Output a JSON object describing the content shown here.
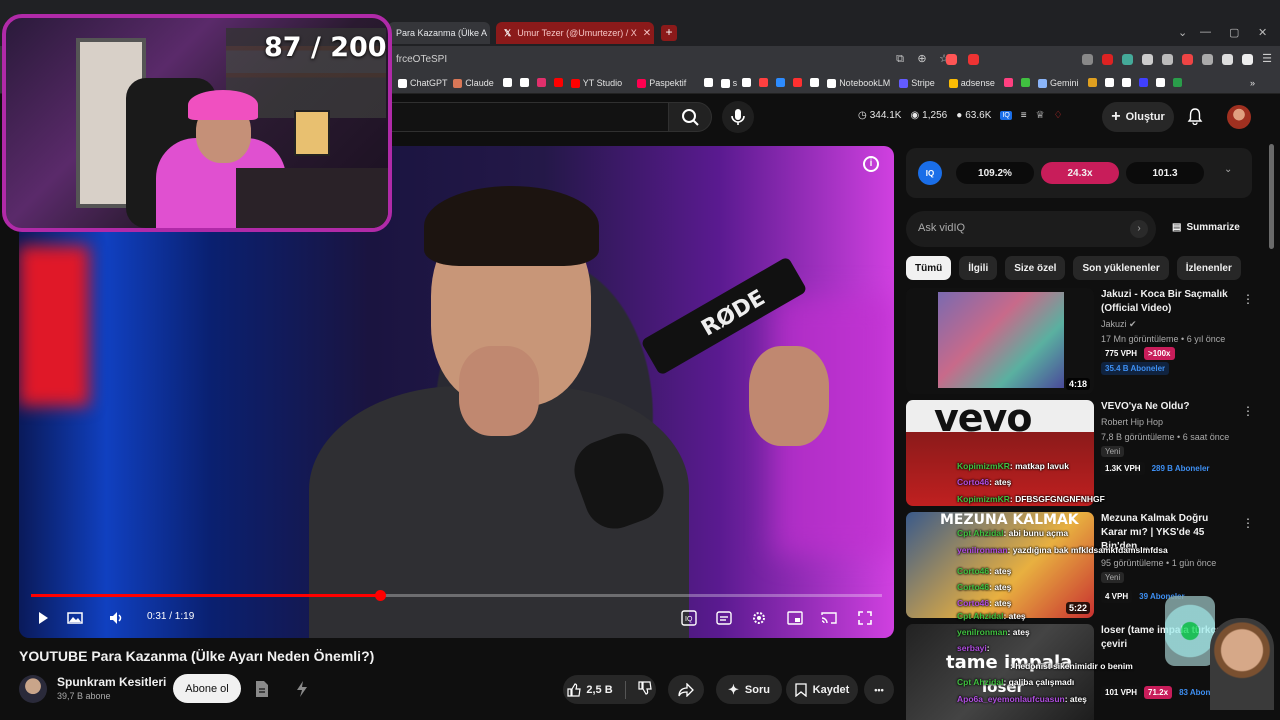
{
  "browser": {
    "tabs": [
      {
        "label": "Para Kazanma (Ülke A",
        "active": true
      },
      {
        "label": "Umur Tezer (@Umurtezer) / X",
        "active": false
      }
    ],
    "new_tab": "+",
    "url": "frceOTeSPI",
    "window_controls": [
      "—",
      "▢",
      "✕"
    ],
    "bookmarks": [
      {
        "label": "ChatGPT",
        "color": "#ffffff"
      },
      {
        "label": "Claude",
        "color": "#d97757"
      },
      {
        "label": "",
        "color": "#ffffff"
      },
      {
        "label": "",
        "color": "#ffffff"
      },
      {
        "label": "",
        "color": "#e1306c"
      },
      {
        "label": "",
        "color": "#ff0000"
      },
      {
        "label": "YT Studio",
        "color": "#ff0000"
      },
      {
        "label": "Paspektif",
        "color": "#ff0050"
      },
      {
        "label": "",
        "color": "#ffffff"
      },
      {
        "label": "s",
        "color": "#ffffff"
      },
      {
        "label": "",
        "color": "#ffffff"
      },
      {
        "label": "",
        "color": "#ff4040"
      },
      {
        "label": "",
        "color": "#2d8cff"
      },
      {
        "label": "",
        "color": "#ff3030"
      },
      {
        "label": "",
        "color": "#ffffff"
      },
      {
        "label": "NotebookLM",
        "color": "#ffffff"
      },
      {
        "label": "Stripe",
        "color": "#635bff"
      },
      {
        "label": "adsense",
        "color": "#fbbc04"
      },
      {
        "label": "",
        "color": "#ff4080"
      },
      {
        "label": "",
        "color": "#40c040"
      },
      {
        "label": "Gemini",
        "color": "#8ab4f8"
      },
      {
        "label": "",
        "color": "#e0a020"
      },
      {
        "label": "",
        "color": "#ffffff"
      },
      {
        "label": "",
        "color": "#ffffff"
      },
      {
        "label": "",
        "color": "#4040ff"
      },
      {
        "label": "",
        "color": "#ffffff"
      },
      {
        "label": "",
        "color": "#2a9d4a"
      }
    ],
    "bookmarks_overflow": "»"
  },
  "youtube": {
    "stats": {
      "views": "344.1K",
      "watchers": "1,256",
      "subs": "63.6K"
    },
    "create_label": "Oluştur"
  },
  "overlay": {
    "goal_counter": "87 / 200"
  },
  "player": {
    "time": "0:31 / 1:19",
    "progress": 0.41,
    "info": "i"
  },
  "video": {
    "title": "YOUTUBE Para Kazanma (Ülke Ayarı Neden Önemli?)",
    "channel": "Spunkram Kesitleri",
    "subscribers": "39,7 B abone",
    "subscribe_label": "Abone ol",
    "likes": "2,5 B",
    "ask_label": "Soru",
    "save_label": "Kaydet",
    "more": "•••"
  },
  "vidiq": {
    "logo": "IQ",
    "metrics": [
      "109.2%",
      "24.3x",
      "101.3"
    ],
    "chevron": "⌄",
    "ask_placeholder": "Ask vidIQ",
    "summarize": "Summarize"
  },
  "chips": [
    "Tümü",
    "İlgili",
    "Size özel",
    "Son yüklenenler",
    "İzlenenler"
  ],
  "recommendations": [
    {
      "title": "Jakuzi - Koca Bir Saçmalık (Official Video)",
      "channel": "Jakuzi",
      "meta": "17 Mn görüntüleme • 6 yıl önce",
      "vph": "775 VPH",
      "hot": "&gt;100x",
      "subs": "35.4 B Aboneler",
      "duration": "4:18",
      "new": "",
      "thumb_text": ""
    },
    {
      "title": "VEVO'ya Ne Oldu?",
      "channel": "Robert Hip Hop",
      "meta": "7,8 B görüntüleme • 6 saat önce",
      "vph": "1.3K VPH",
      "hot": "",
      "subs": "289 B Aboneler",
      "duration": "",
      "new": "Yeni",
      "thumb_text": "vevo"
    },
    {
      "title": "Mezuna Kalmak Doğru Karar mı? | YKS'de 45 Bin'den ...",
      "channel": "",
      "meta": "95 görüntüleme • 1 gün önce",
      "vph": "4 VPH",
      "hot": "",
      "subs": "39 Aboneler",
      "duration": "5:22",
      "new": "Yeni",
      "thumb_text": "MEZUNA KALMAK"
    },
    {
      "title": "loser (tame impala türkçe çeviri",
      "channel": "",
      "meta": "",
      "vph": "101 VPH",
      "hot": "71.2x",
      "subs": "83 Aboneler",
      "duration": "",
      "new": "",
      "thumb_text": "tame impala"
    }
  ],
  "chat": [
    {
      "user": "KopimizmKR",
      "msg": ": matkap lavuk"
    },
    {
      "user": "Corto46",
      "msg": ": ateş"
    },
    {
      "user": "KopimizmKR",
      "msg": ": DFBSGFGNGNFNHGF"
    },
    {
      "user": "Cpt Ahzidal",
      "msg": ": abi bunu açma"
    },
    {
      "user": "yenilronman",
      "msg": ": yazdığına bak mfkldsamkfdamslmfdsa"
    },
    {
      "user": "Corto46",
      "msg": ": ateş"
    },
    {
      "user": "Corto46",
      "msg": ": ateş"
    },
    {
      "user": "Corto46",
      "msg": ": ateş"
    },
    {
      "user": "Cpt Ahzidal",
      "msg": ": ateş"
    },
    {
      "user": "yenilronman",
      "msg": ": ateş"
    },
    {
      "user": "serbayi",
      "msg": ": "
    },
    {
      "user": "",
      "msg": ": hedonist sikenimidir o benim"
    },
    {
      "user": "Cpt Ahzidal",
      "msg": ": galiba çalışmadı"
    },
    {
      "user": "Apo6a_eyemonlaufcuasun",
      "msg": ": ateş"
    }
  ],
  "colors": {
    "yt_bg": "#0f0f0f",
    "accent_red": "#ff0000",
    "vidiq_blue": "#1a6ee8",
    "vidiq_hot": "#c81d5a",
    "webcam_border": "#b02aa8"
  }
}
